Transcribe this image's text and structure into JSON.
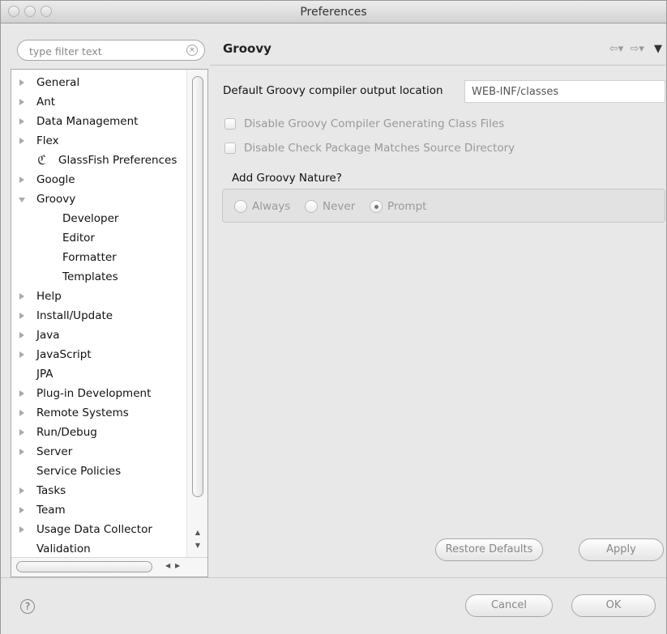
{
  "window": {
    "title": "Preferences"
  },
  "filter": {
    "placeholder": "type filter text"
  },
  "tree": {
    "items": [
      {
        "label": "General",
        "arrow": "collapsed"
      },
      {
        "label": "Ant",
        "arrow": "collapsed"
      },
      {
        "label": "Data Management",
        "arrow": "collapsed"
      },
      {
        "label": "Flex",
        "arrow": "collapsed"
      },
      {
        "label": "GlassFish Preferences",
        "arrow": "none",
        "icon": "glassfish-icon"
      },
      {
        "label": "Google",
        "arrow": "collapsed"
      },
      {
        "label": "Groovy",
        "arrow": "expanded",
        "selected": true
      },
      {
        "label": "Developer",
        "arrow": "none",
        "child": true
      },
      {
        "label": "Editor",
        "arrow": "none",
        "child": true
      },
      {
        "label": "Formatter",
        "arrow": "none",
        "child": true
      },
      {
        "label": "Templates",
        "arrow": "none",
        "child": true
      },
      {
        "label": "Help",
        "arrow": "collapsed"
      },
      {
        "label": "Install/Update",
        "arrow": "collapsed"
      },
      {
        "label": "Java",
        "arrow": "collapsed"
      },
      {
        "label": "JavaScript",
        "arrow": "collapsed"
      },
      {
        "label": "JPA",
        "arrow": "none"
      },
      {
        "label": "Plug-in Development",
        "arrow": "collapsed"
      },
      {
        "label": "Remote Systems",
        "arrow": "collapsed"
      },
      {
        "label": "Run/Debug",
        "arrow": "collapsed"
      },
      {
        "label": "Server",
        "arrow": "collapsed"
      },
      {
        "label": "Service Policies",
        "arrow": "none"
      },
      {
        "label": "Tasks",
        "arrow": "collapsed"
      },
      {
        "label": "Team",
        "arrow": "collapsed"
      },
      {
        "label": "Usage Data Collector",
        "arrow": "collapsed"
      },
      {
        "label": "Validation",
        "arrow": "none"
      }
    ]
  },
  "page": {
    "title": "Groovy",
    "output_label": "Default Groovy compiler output location",
    "output_value": "WEB-INF/classes",
    "checkboxes": [
      {
        "label": "Disable Groovy Compiler Generating Class Files",
        "checked": false
      },
      {
        "label": "Disable Check Package Matches Source Directory",
        "checked": false
      }
    ],
    "nature_title": "Add Groovy Nature?",
    "nature_options": [
      {
        "label": "Always",
        "checked": false
      },
      {
        "label": "Never",
        "checked": false
      },
      {
        "label": "Prompt",
        "checked": true
      }
    ],
    "restore_label": "Restore Defaults",
    "apply_label": "Apply"
  },
  "nav": {
    "back": "⇦▾",
    "forward": "⇨▾",
    "menu": "▼"
  },
  "footer": {
    "help": "?",
    "cancel_label": "Cancel",
    "ok_label": "OK"
  }
}
